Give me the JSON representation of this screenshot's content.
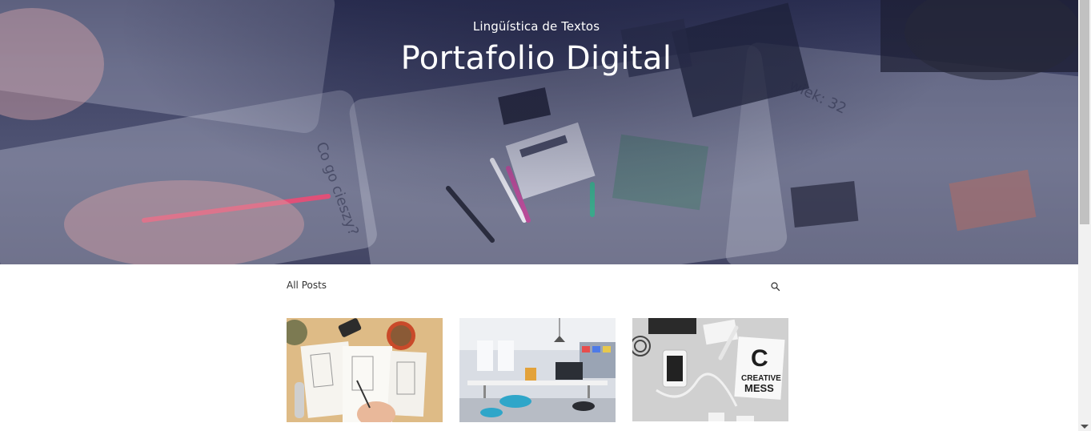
{
  "hero": {
    "subtitle": "Lingüística de Textos",
    "title": "Portafolio Digital"
  },
  "posts_nav": {
    "all_posts_label": "All Posts",
    "search_icon": "search-icon"
  },
  "cards": [
    {
      "image": "wireframe-sketching-photo"
    },
    {
      "image": "open-office-photo"
    },
    {
      "image": "creative-mess-desk-photo",
      "image_text": "C CREATIVE MESS"
    }
  ],
  "colors": {
    "hero_overlay": "#2a2e52",
    "text_light": "#ffffff",
    "text_dark": "#333333",
    "scrollbar_track": "#f1f1f1",
    "scrollbar_thumb": "#c1c1c1"
  }
}
